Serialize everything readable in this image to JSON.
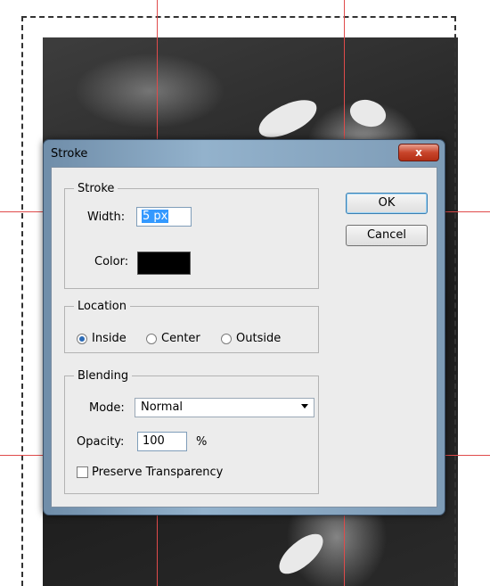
{
  "dialog": {
    "title": "Stroke",
    "close_glyph": "x",
    "stroke_group": {
      "legend": "Stroke",
      "width_label": "Width:",
      "width_value": "5 px",
      "color_label": "Color:",
      "color_value": "#000000"
    },
    "location_group": {
      "legend": "Location",
      "options": [
        "Inside",
        "Center",
        "Outside"
      ],
      "selected": "Inside"
    },
    "blending_group": {
      "legend": "Blending",
      "mode_label": "Mode:",
      "mode_value": "Normal",
      "opacity_label": "Opacity:",
      "opacity_value": "100",
      "opacity_unit": "%",
      "preserve_label": "Preserve Transparency",
      "preserve_checked": false
    },
    "ok_label": "OK",
    "cancel_label": "Cancel"
  },
  "colors": {
    "guide": "#e04b4b",
    "titlebar": "#93b2cc",
    "close": "#c8452b"
  }
}
